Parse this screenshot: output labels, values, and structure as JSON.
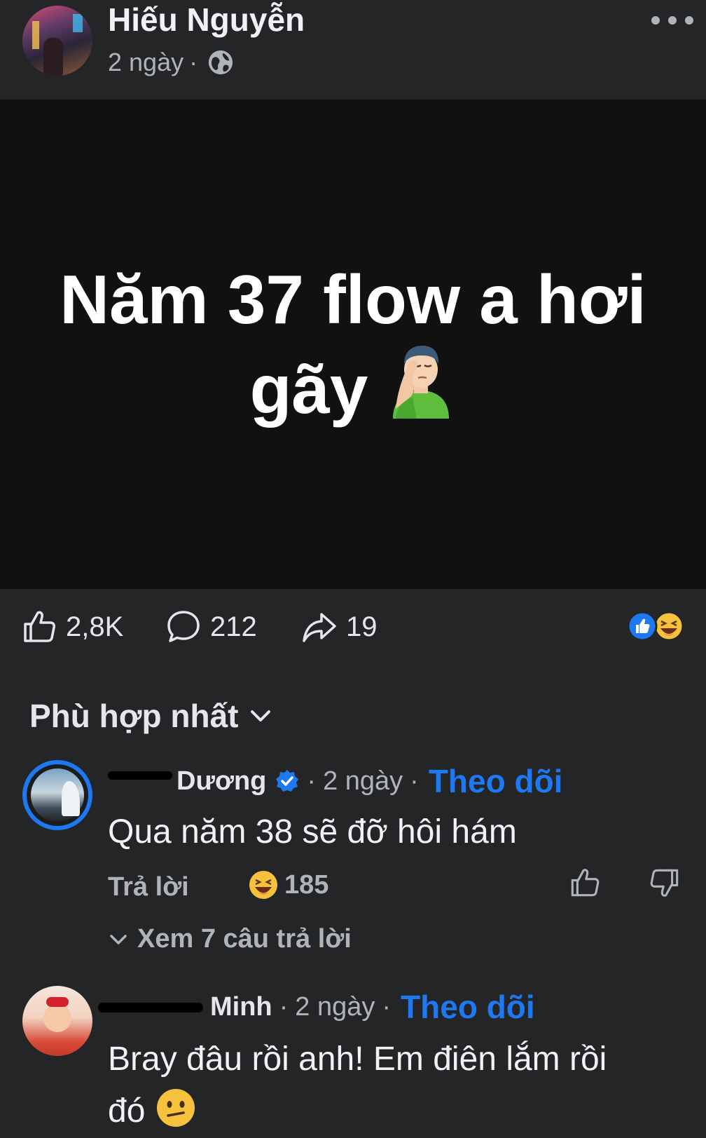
{
  "post": {
    "author": "Hiếu Nguyễn",
    "time": "2 ngày",
    "separator": "·",
    "privacy_icon": "globe-icon",
    "menu_icon": "more-icon",
    "text_line1": "Năm 37 flow a hơi",
    "text_line2": "gãy",
    "emoji": "facepalm-emoji",
    "card_background": "#111112"
  },
  "stats": {
    "likes": "2,8K",
    "comments": "212",
    "shares": "19",
    "reactions": [
      "like-reaction-icon",
      "haha-reaction-icon"
    ]
  },
  "sort": {
    "label": "Phù hợp nhất"
  },
  "comments": [
    {
      "name": "Dương",
      "verified": true,
      "time": "2 ngày",
      "follow": "Theo dõi",
      "text": "Qua năm 38 sẽ đỡ hôi hám",
      "reply_label": "Trả lời",
      "reaction_count": "185",
      "view_replies": "Xem 7 câu trả lời"
    },
    {
      "name": "Minh",
      "time": "2 ngày",
      "follow": "Theo dõi",
      "text_line1": "Bray đâu rồi anh! Em điên lắm rồi",
      "text_line2": "đó"
    }
  ],
  "colors": {
    "background": "#242527",
    "accent": "#1d78f2",
    "muted": "#b0b3b8",
    "text": "#e4e6eb"
  }
}
